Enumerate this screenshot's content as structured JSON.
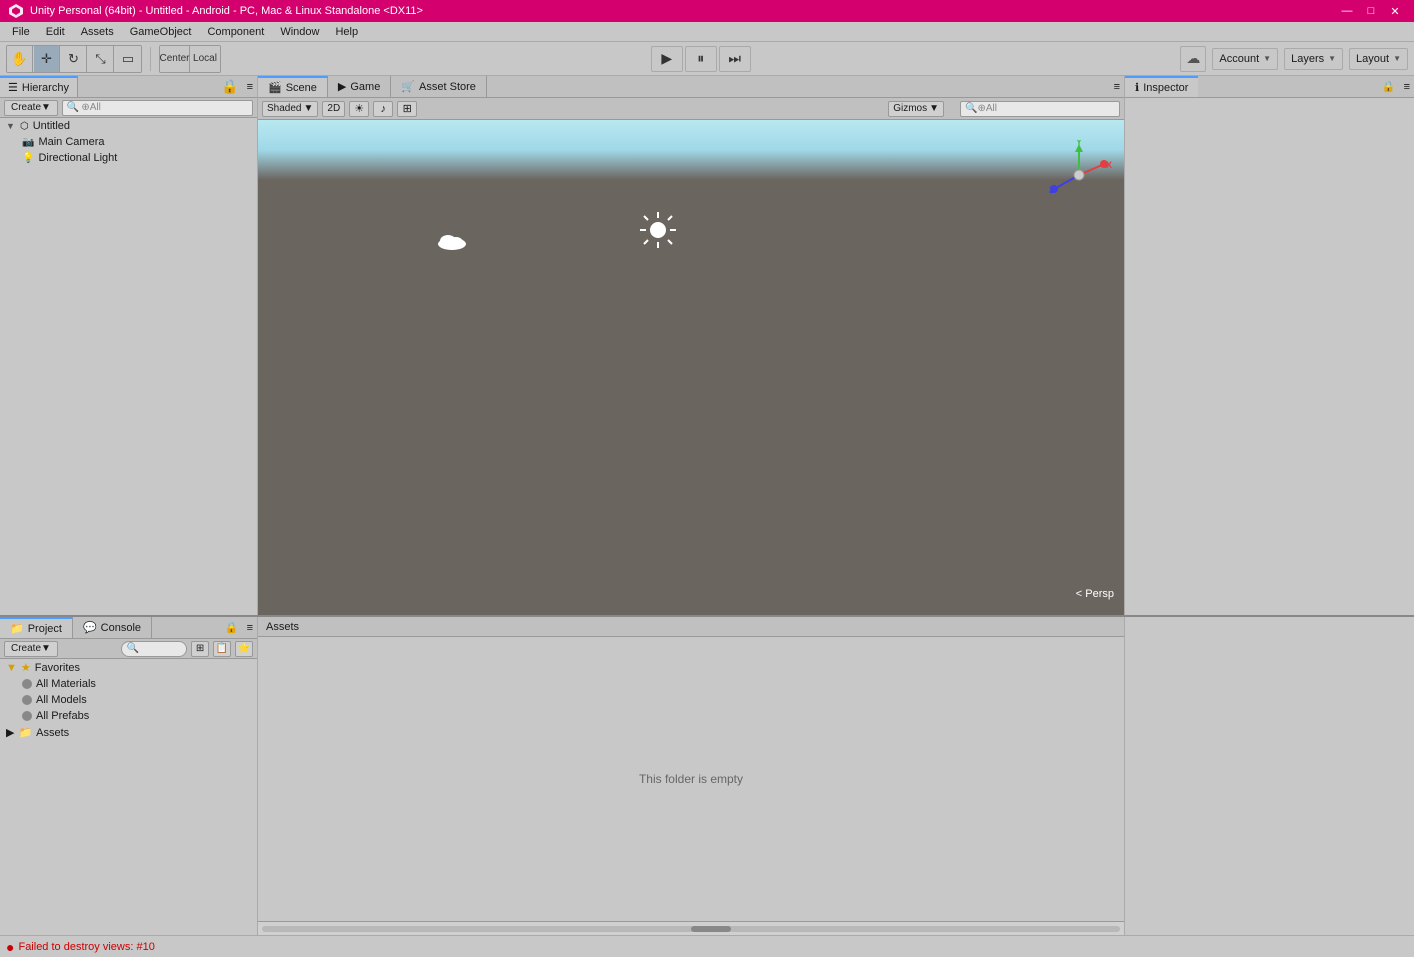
{
  "titlebar": {
    "title": "Unity Personal (64bit) - Untitled - Android - PC, Mac & Linux Standalone <DX11>",
    "minimize": "—",
    "maximize": "□",
    "close": "✕"
  },
  "menubar": {
    "items": [
      "File",
      "Edit",
      "Assets",
      "GameObject",
      "Component",
      "Window",
      "Help"
    ]
  },
  "toolbar": {
    "tools": [
      "hand",
      "move",
      "rotate",
      "scale",
      "rect",
      "multi"
    ],
    "center_label1": "Center",
    "center_label2": "Local",
    "play": "▶",
    "pause": "⏸",
    "step": "⏭",
    "cloud_icon": "☁",
    "account": "Account",
    "layers": "Layers",
    "layout": "Layout"
  },
  "hierarchy": {
    "tab_label": "Hierarchy",
    "create_label": "Create",
    "search_placeholder": "⊕All",
    "items": [
      {
        "label": "Untitled",
        "indent": 0,
        "expanded": true
      },
      {
        "label": "Main Camera",
        "indent": 1
      },
      {
        "label": "Directional Light",
        "indent": 1
      }
    ]
  },
  "scene": {
    "tabs": [
      "Scene",
      "Game",
      "Asset Store"
    ],
    "active_tab": "Scene",
    "shading_mode": "Shaded",
    "view_2d": "2D",
    "sun_icon": "☀",
    "audio_icon": "♪",
    "img_icon": "⊞",
    "gizmos_label": "Gizmos",
    "search_placeholder": "⊕All",
    "persp_label": "< Persp",
    "gizmo_x": "x",
    "gizmo_y": "Y",
    "gizmo_z": "Z"
  },
  "inspector": {
    "tab_label": "Inspector",
    "empty": true
  },
  "project": {
    "tabs": [
      "Project",
      "Console"
    ],
    "active_tab": "Project",
    "create_label": "Create",
    "favorites_label": "Favorites",
    "all_materials": "All Materials",
    "all_models": "All Models",
    "all_prefabs": "All Prefabs",
    "assets_label": "Assets"
  },
  "asset_area": {
    "header": "Assets",
    "empty_message": "This folder is empty"
  },
  "statusbar": {
    "error_icon": "●",
    "error_message": "Failed to destroy views: #10"
  }
}
